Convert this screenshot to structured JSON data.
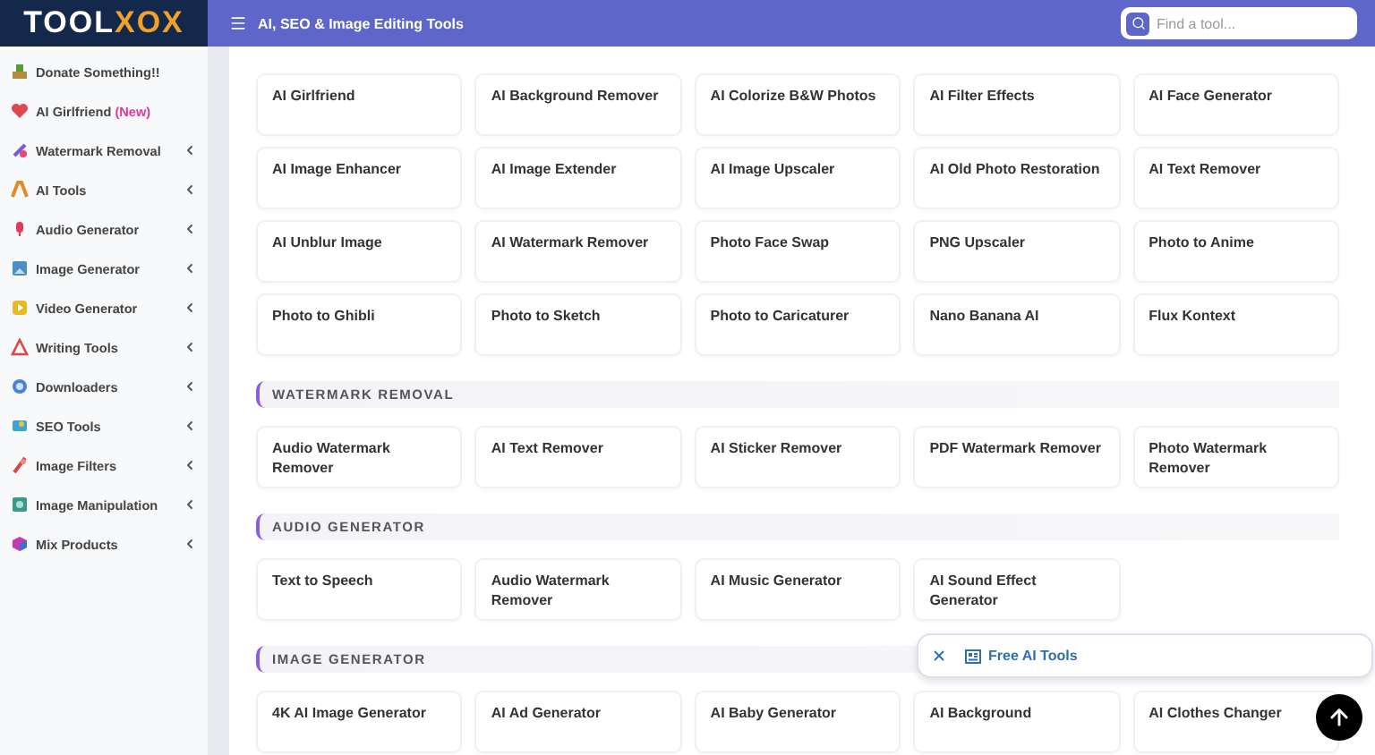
{
  "logo": {
    "part_1": "TOOL",
    "part_2": "XOX"
  },
  "header": {
    "title": "AI, SEO & Image Editing Tools",
    "search": {
      "placeholder": "Find a tool..."
    }
  },
  "sidebar": {
    "items": [
      {
        "label": "Donate Something!!",
        "has_submenu": false
      },
      {
        "label": "AI Girlfriend",
        "badge": "(New)",
        "has_submenu": false
      },
      {
        "label": "Watermark Removal",
        "has_submenu": true
      },
      {
        "label": "AI Tools",
        "has_submenu": true
      },
      {
        "label": "Audio Generator",
        "has_submenu": true
      },
      {
        "label": "Image Generator",
        "has_submenu": true
      },
      {
        "label": "Video Generator",
        "has_submenu": true
      },
      {
        "label": "Writing Tools",
        "has_submenu": true
      },
      {
        "label": "Downloaders",
        "has_submenu": true
      },
      {
        "label": "SEO Tools",
        "has_submenu": true
      },
      {
        "label": "Image Filters",
        "has_submenu": true
      },
      {
        "label": "Image Manipulation",
        "has_submenu": true
      },
      {
        "label": "Mix Products",
        "has_submenu": true
      }
    ]
  },
  "sections": [
    {
      "tools": [
        "AI Girlfriend",
        "AI Background Remover",
        "AI Colorize B&W Photos",
        "AI Filter Effects",
        "AI Face Generator",
        "AI Image Enhancer",
        "AI Image Extender",
        "AI Image Upscaler",
        "AI Old Photo Restoration",
        "AI Text Remover",
        "AI Unblur Image",
        "AI Watermark Remover",
        "Photo Face Swap",
        "PNG Upscaler",
        "Photo to Anime",
        "Photo to Ghibli",
        "Photo to Sketch",
        "Photo to Caricaturer",
        "Nano Banana AI",
        "Flux Kontext"
      ]
    },
    {
      "title": "WATERMARK REMOVAL",
      "tools": [
        "Audio Watermark Remover",
        "AI Text Remover",
        "AI Sticker Remover",
        "PDF Watermark Remover",
        "Photo Watermark Remover"
      ]
    },
    {
      "title": "AUDIO GENERATOR",
      "tools": [
        "Text to Speech",
        "Audio Watermark Remover",
        "AI Music Generator",
        "AI Sound Effect Generator"
      ]
    },
    {
      "title": "IMAGE GENERATOR",
      "tools": [
        "4K AI Image Generator",
        "AI Ad Generator",
        "AI Baby Generator",
        "AI Background",
        "AI Clothes Changer"
      ]
    }
  ],
  "popup": {
    "label": "Free AI Tools"
  }
}
